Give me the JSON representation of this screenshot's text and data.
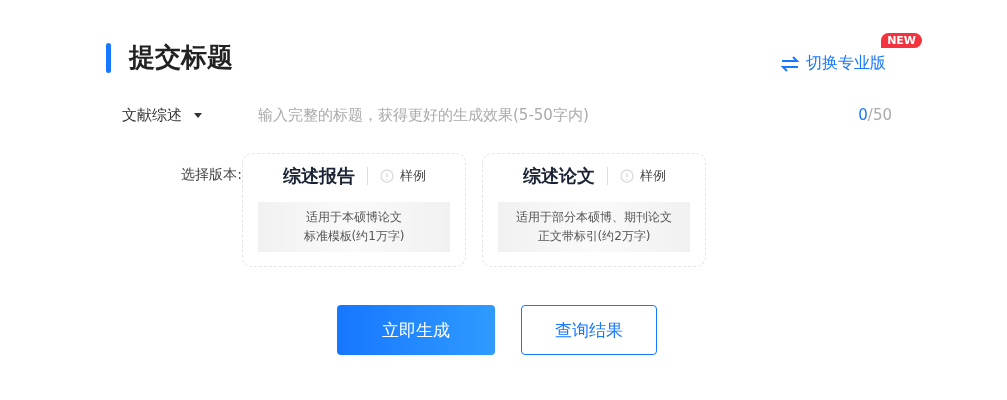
{
  "title": "提交标题",
  "switch_link": {
    "label": "切换专业版",
    "badge": "NEW"
  },
  "title_field": {
    "type_label": "文献综述",
    "placeholder": "输入完整的标题，获得更好的生成效果(5-50字内)",
    "count": "0",
    "limit": "/50"
  },
  "version_label": "选择版本:",
  "versions": [
    {
      "name": "综述报告",
      "sample": "样例",
      "lines": [
        "适用于本硕博论文",
        "标准模板(约1万字)"
      ]
    },
    {
      "name": "综述论文",
      "sample": "样例",
      "lines": [
        "适用于部分本硕博、期刊论文",
        "正文带标引(约2万字)"
      ]
    }
  ],
  "buttons": [
    {
      "label": "立即生成",
      "kind": "primary"
    },
    {
      "label": "查询结果",
      "kind": "outline"
    }
  ]
}
